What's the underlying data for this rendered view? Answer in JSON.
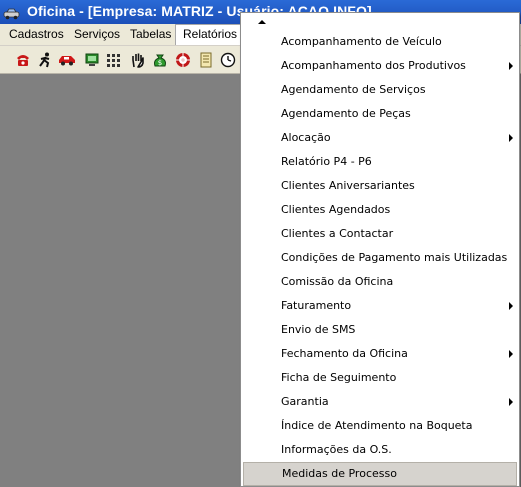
{
  "window": {
    "title": "Oficina - [Empresa: MATRIZ - Usuário: ACAO INFO]",
    "icon": "car-icon"
  },
  "menubar": {
    "items": [
      {
        "label": "Cadastros"
      },
      {
        "label": "Serviços"
      },
      {
        "label": "Tabelas"
      },
      {
        "label": "Relatórios",
        "active": true
      }
    ]
  },
  "toolbar": {
    "icons": [
      "telephone-icon",
      "running-man-icon",
      "car-icon",
      "monitor-icon",
      "calculator-icon",
      "hand-icon",
      "money-bag-icon",
      "wheel-icon",
      "document-icon",
      "clock-icon"
    ]
  },
  "dropdown": {
    "items": [
      {
        "label": "Acompanhamento de Veículo",
        "submenu": false
      },
      {
        "label": "Acompanhamento dos Produtivos",
        "submenu": true
      },
      {
        "label": "Agendamento de Serviços",
        "submenu": false
      },
      {
        "label": "Agendamento de Peças",
        "submenu": false
      },
      {
        "label": "Alocação",
        "submenu": true
      },
      {
        "label": "Relatório P4 - P6",
        "submenu": false
      },
      {
        "label": "Clientes Aniversariantes",
        "submenu": false
      },
      {
        "label": "Clientes Agendados",
        "submenu": false
      },
      {
        "label": "Clientes a Contactar",
        "submenu": false
      },
      {
        "label": "Condições de Pagamento mais Utilizadas",
        "submenu": false
      },
      {
        "label": "Comissão da Oficina",
        "submenu": false
      },
      {
        "label": "Faturamento",
        "submenu": true
      },
      {
        "label": "Envio de SMS",
        "submenu": false
      },
      {
        "label": "Fechamento da Oficina",
        "submenu": true
      },
      {
        "label": "Ficha de Seguimento",
        "submenu": false
      },
      {
        "label": "Garantia",
        "submenu": true
      },
      {
        "label": "Índice de Atendimento na Boqueta",
        "submenu": false
      },
      {
        "label": "Informações da O.S.",
        "submenu": false
      },
      {
        "label": "Medidas de Processo",
        "submenu": false,
        "highlighted": true
      }
    ]
  }
}
